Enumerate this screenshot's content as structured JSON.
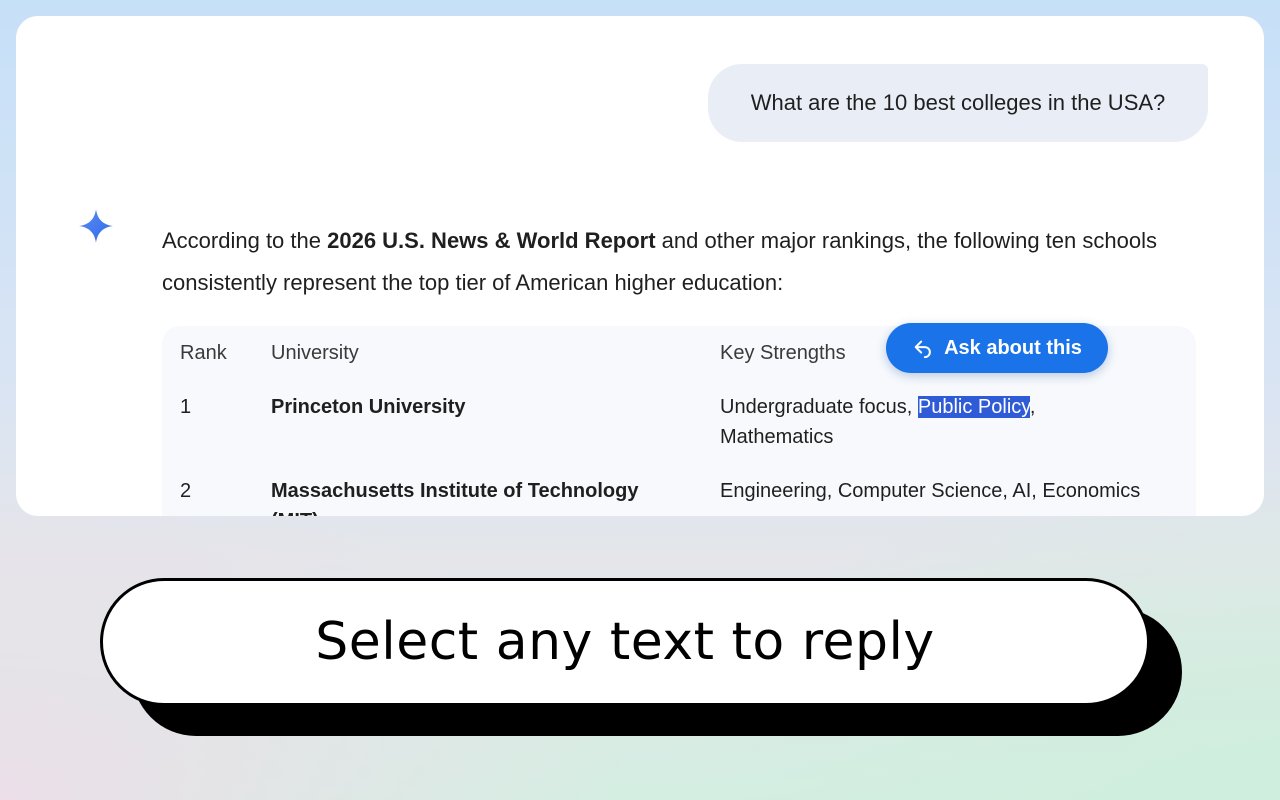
{
  "chat": {
    "user_message": "What are the 10 best colleges in the USA?",
    "ai_intro": {
      "before": "According to the ",
      "bold": "2026 U.S. News & World Report",
      "after": " and other major rankings, the following ten schools consistently represent the top tier of American higher education:"
    },
    "table": {
      "headers": [
        "Rank",
        "University",
        "Key Strengths"
      ],
      "rows": [
        {
          "rank": "1",
          "university": "Princeton University",
          "strengths_before": "Undergraduate focus, ",
          "strengths_selected": "Public Policy",
          "strengths_after": ",",
          "strengths_line2": "Mathematics"
        },
        {
          "rank": "2",
          "university": "Massachusetts Institute of Technology",
          "university_line2": "(MIT)",
          "strengths": "Engineering, Computer Science, AI, Economics"
        }
      ]
    },
    "ask_button_label": "Ask about this",
    "icons": {
      "assistant": "sparkle-icon",
      "ask": "reply-arrow-icon"
    }
  },
  "banner": {
    "text": "Select any text to reply"
  },
  "colors": {
    "accent": "#1a73e8",
    "sparkle": "#4285f4",
    "selection": "#2f5bd6",
    "user_bubble": "#e9eef6"
  }
}
